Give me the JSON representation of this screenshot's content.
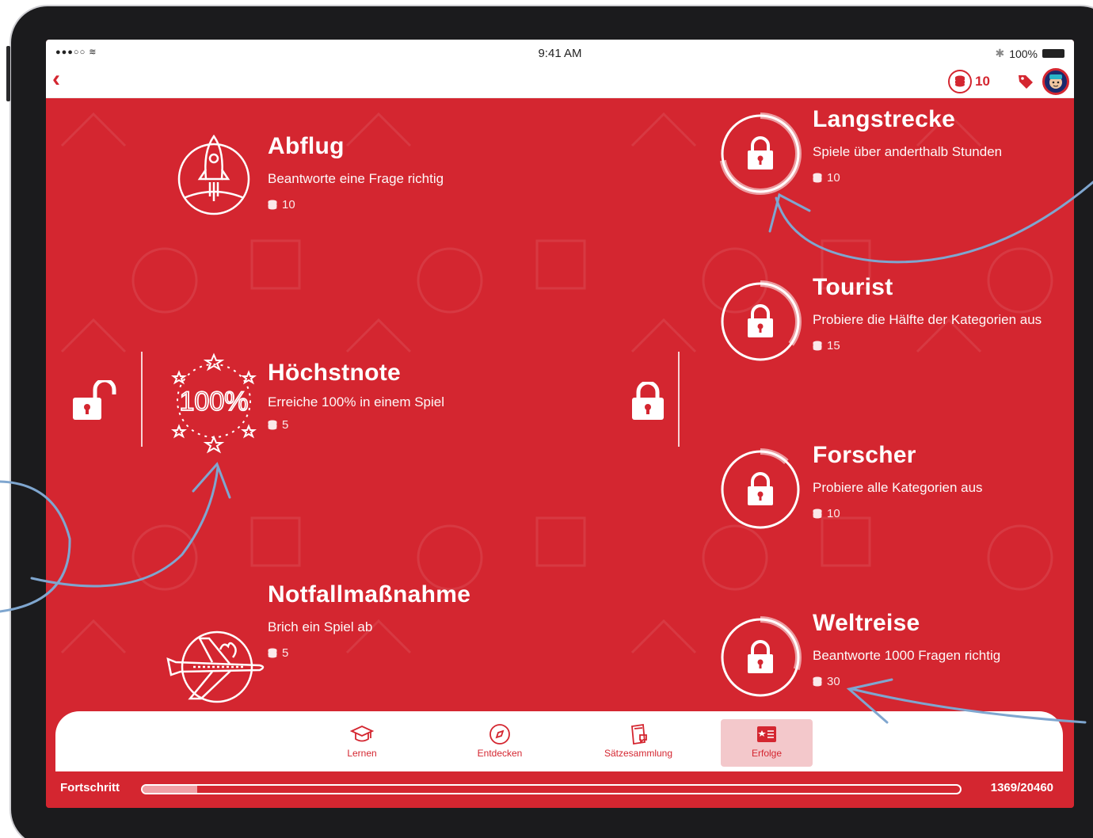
{
  "status_bar": {
    "signal": "●●●○○ ",
    "time": "9:41 AM",
    "battery": "100%"
  },
  "nav": {
    "coins": "10",
    "colors": {
      "accent": "#d42630",
      "tab_active_bg": "#f3c8cb"
    }
  },
  "achievements_left": [
    {
      "title": "Abflug",
      "desc": "Beantworte eine Frage richtig",
      "reward": "10",
      "icon": "rocket-icon"
    },
    {
      "title": "Höchstnote",
      "desc": "Erreiche 100% in einem Spiel",
      "reward": "5",
      "icon": "hundred-percent-icon"
    },
    {
      "title": "Notfallmaßnahme",
      "desc": "Brich ein Spiel ab",
      "reward": "5",
      "icon": "burning-plane-icon"
    }
  ],
  "achievements_right": [
    {
      "title": "Langstrecke",
      "desc": "Spiele über anderthalb Stunden",
      "reward": "10",
      "progress": 0.72
    },
    {
      "title": "Tourist",
      "desc": "Probiere die Hälfte der Kategorien aus",
      "reward": "15",
      "progress": 0.35
    },
    {
      "title": "Forscher",
      "desc": "Probiere alle Kategorien aus",
      "reward": "10",
      "progress": 0.12
    },
    {
      "title": "Weltreise",
      "desc": "Beantworte 1000 Fragen richtig",
      "reward": "30",
      "progress": 0.3
    }
  ],
  "tabs": [
    {
      "label": "Lernen",
      "icon": "graduation-cap-icon",
      "active": false
    },
    {
      "label": "Entdecken",
      "icon": "compass-icon",
      "active": false
    },
    {
      "label": "Sätzesammlung",
      "icon": "phrasebook-icon",
      "active": false
    },
    {
      "label": "Erfolge",
      "icon": "trophy-card-icon",
      "active": true
    }
  ],
  "progress": {
    "label": "Fortschritt",
    "count": "1369/20460",
    "fraction": 0.067
  }
}
